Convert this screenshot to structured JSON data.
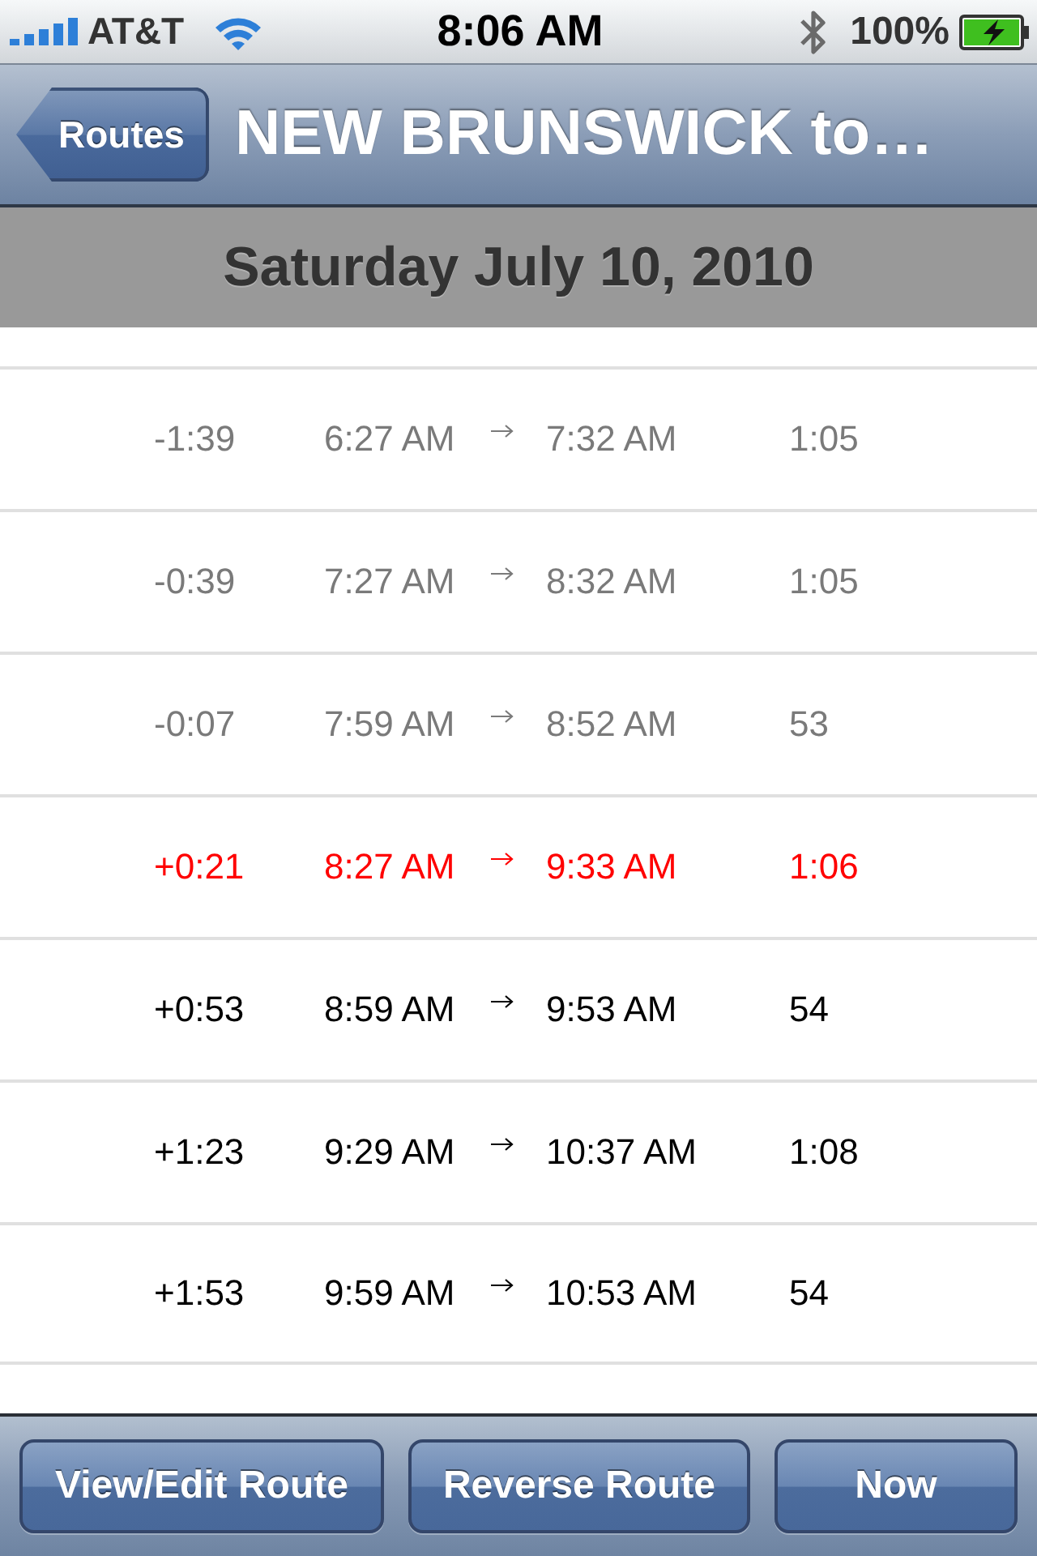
{
  "status_bar": {
    "carrier": "AT&T",
    "time": "8:06 AM",
    "battery": "100%",
    "charging": true
  },
  "nav_bar": {
    "back": "Routes",
    "title": "NEW BRUNSWICK to…"
  },
  "date": "Saturday July 10, 2010",
  "trips": [
    {
      "kind": "past",
      "offset": "-1:39",
      "depart": "6:27 AM",
      "arrive": "7:32 AM",
      "duration": "1:05"
    },
    {
      "kind": "past",
      "offset": "-0:39",
      "depart": "7:27 AM",
      "arrive": "8:32 AM",
      "duration": "1:05"
    },
    {
      "kind": "past",
      "offset": "-0:07",
      "depart": "7:59 AM",
      "arrive": "8:52 AM",
      "duration": "53"
    },
    {
      "kind": "next",
      "offset": "+0:21",
      "depart": "8:27 AM",
      "arrive": "9:33 AM",
      "duration": "1:06"
    },
    {
      "kind": "upcoming",
      "offset": "+0:53",
      "depart": "8:59 AM",
      "arrive": "9:53 AM",
      "duration": "54"
    },
    {
      "kind": "upcoming",
      "offset": "+1:23",
      "depart": "9:29 AM",
      "arrive": "10:37 AM",
      "duration": "1:08"
    },
    {
      "kind": "upcoming",
      "offset": "+1:53",
      "depart": "9:59 AM",
      "arrive": "10:53 AM",
      "duration": "54"
    }
  ],
  "toolbar": {
    "buttons": [
      "View/Edit Route",
      "Reverse Route",
      "Now"
    ]
  }
}
